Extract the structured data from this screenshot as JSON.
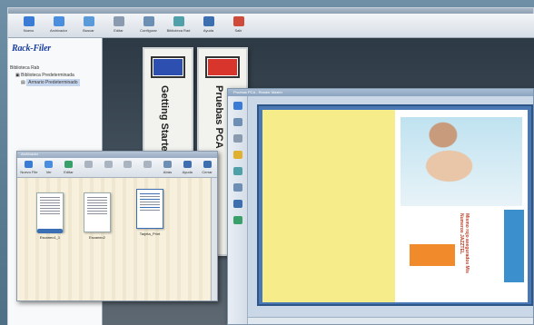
{
  "main_toolbar": {
    "buttons": [
      {
        "label": "Nuevo",
        "icon": "new-icon",
        "color": "#3a7bd5"
      },
      {
        "label": "Archivador",
        "icon": "archive-icon",
        "color": "#4a8ee0"
      },
      {
        "label": "Buscar",
        "icon": "search-icon",
        "color": "#5b9ad9"
      },
      {
        "label": "Editar",
        "icon": "edit-icon",
        "color": "#8a9bb0"
      },
      {
        "label": "Configurar",
        "icon": "settings-icon",
        "color": "#6c8fb3"
      },
      {
        "label": "Biblioteca Rad",
        "icon": "library-icon",
        "color": "#4fa0a8"
      },
      {
        "label": "Ayuda",
        "icon": "help-icon",
        "color": "#3d6fb0"
      },
      {
        "label": "Salir",
        "icon": "exit-icon",
        "color": "#d04a3a"
      }
    ]
  },
  "sidebar": {
    "logo": "Rack-Filer",
    "tree": [
      {
        "label": "Biblioteca Rab"
      },
      {
        "label": "Biblioteca Predeterminada"
      },
      {
        "label": "Armario Predeterminado"
      }
    ]
  },
  "binders": [
    {
      "title": "Getting Started",
      "color": "#2c4fb0"
    },
    {
      "title": "Pruebas PCA",
      "color": "#d8352c"
    }
  ],
  "folder_window": {
    "title": "Archivador",
    "toolbar": [
      {
        "label": "Nuevo File",
        "color": "#3a7bd5"
      },
      {
        "label": "Ver",
        "color": "#4a8ee0"
      },
      {
        "label": "Editar",
        "color": "#3aa06a"
      },
      {
        "label": "",
        "color": "#aab4c0"
      },
      {
        "label": "",
        "color": "#aab4c0"
      },
      {
        "label": "",
        "color": "#aab4c0"
      },
      {
        "label": "",
        "color": "#aab4c0"
      },
      {
        "label": "Atrás",
        "color": "#6c8fb3"
      },
      {
        "label": "Ayuda",
        "color": "#3d6fb0"
      },
      {
        "label": "Cerrar",
        "color": "#3d6fb0"
      }
    ],
    "documents": [
      {
        "name": "Escaneo1_1"
      },
      {
        "name": "Escaneo2"
      },
      {
        "name": "Tarjeta_Print"
      }
    ]
  },
  "reader_window": {
    "title": "Pruebas PCA - Reader Master",
    "status": "",
    "ad": {
      "text": "Mismo rojo asegurados\nMis Numeros JAZZTEL",
      "brand_color": "#f08a2a"
    }
  }
}
